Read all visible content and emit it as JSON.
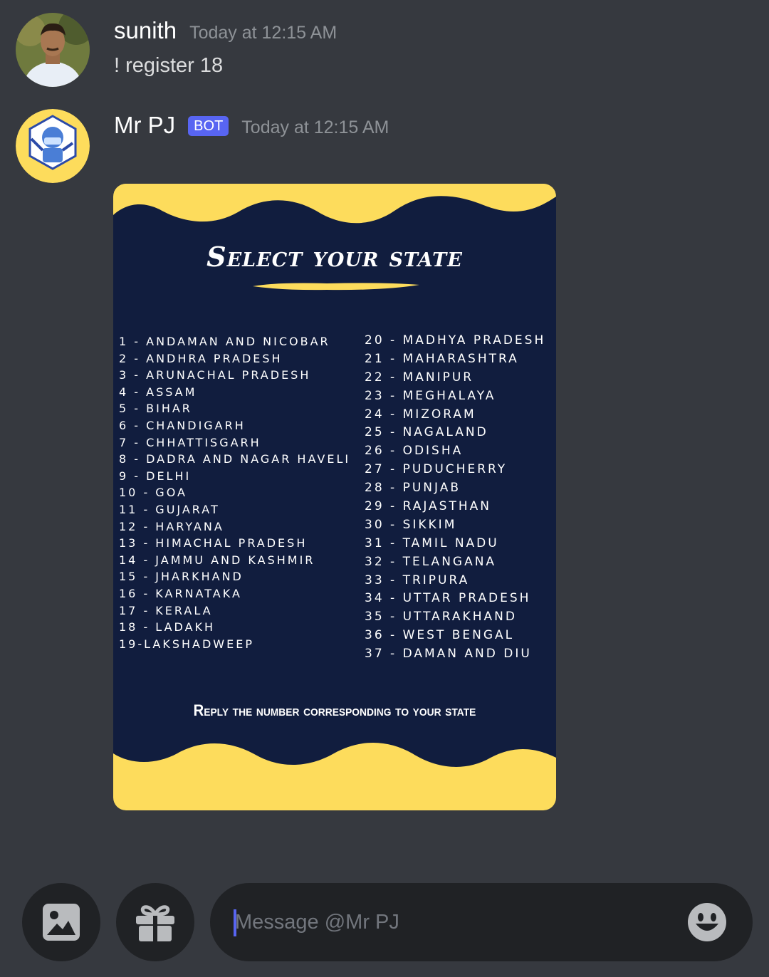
{
  "messages": [
    {
      "author": "sunith",
      "timestamp": "Today at 12:15 AM",
      "text": "! register 18"
    },
    {
      "author": "Mr PJ",
      "badge": "BOT",
      "timestamp": "Today at 12:15 AM",
      "avatar_text": "Mr PJ"
    }
  ],
  "card": {
    "title": "Select your state",
    "left_states": [
      "1 - ANDAMAN AND NICOBAR",
      "2 - ANDHRA PRADESH",
      "3 - ARUNACHAL PRADESH",
      "4 - ASSAM",
      "5 - BIHAR",
      "6 - CHANDIGARH",
      "7 - CHHATTISGARH",
      "8 - DADRA AND NAGAR HAVELI",
      "9 - DELHI",
      "10 - GOA",
      "11 - GUJARAT",
      "12 - HARYANA",
      "13 - HIMACHAL PRADESH",
      "14 - JAMMU AND KASHMIR",
      "15 - JHARKHAND",
      "16 - KARNATAKA",
      "17 - KERALA",
      "18 - LADAKH",
      "19-LAKSHADWEEP"
    ],
    "right_states": [
      "20 - MADHYA PRADESH",
      "21 - MAHARASHTRA",
      "22 - MANIPUR",
      "23 - MEGHALAYA",
      "24 - MIZORAM",
      "25 - NAGALAND",
      "26 - ODISHA",
      "27 - PUDUCHERRY",
      "28 - PUNJAB",
      "29 - RAJASTHAN",
      "30 - SIKKIM",
      "31 - TAMIL NADU",
      "32 - TELANGANA",
      "33 - TRIPURA",
      "34 - UTTAR PRADESH",
      "35 - UTTARAKHAND",
      "36 - WEST BENGAL",
      "37 - DAMAN AND DIU"
    ],
    "footer": "Reply the number corresponding to your state"
  },
  "composer": {
    "placeholder": "Message @Mr PJ"
  },
  "icons": {
    "attach_image": "image-icon",
    "gift": "gift-icon",
    "emoji": "emoji-icon"
  },
  "colors": {
    "background": "#36393f",
    "composer_bg": "#202225",
    "badge": "#5865f2",
    "card_navy": "#111d3e",
    "card_yellow": "#fddc5c"
  }
}
